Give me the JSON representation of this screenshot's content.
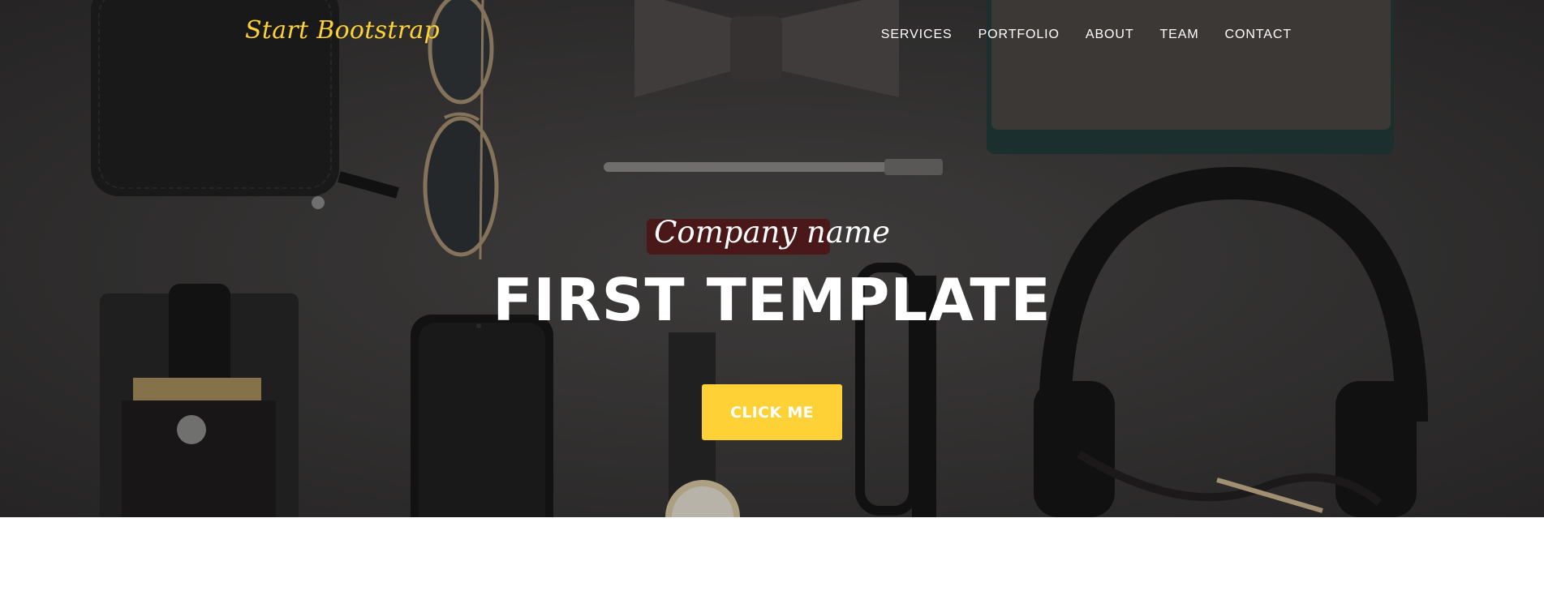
{
  "nav": {
    "brand": "Start Bootstrap",
    "links": [
      "SERVICES",
      "PORTFOLIO",
      "ABOUT",
      "TEAM",
      "CONTACT"
    ]
  },
  "hero": {
    "subtitle": "Company name",
    "title": "FIRST TEMPLATE",
    "button_label": "CLICK ME"
  },
  "colors": {
    "accent": "#fed136",
    "hero_background": "#3a3837",
    "text": "#ffffff",
    "page_background": "#ffffff"
  }
}
